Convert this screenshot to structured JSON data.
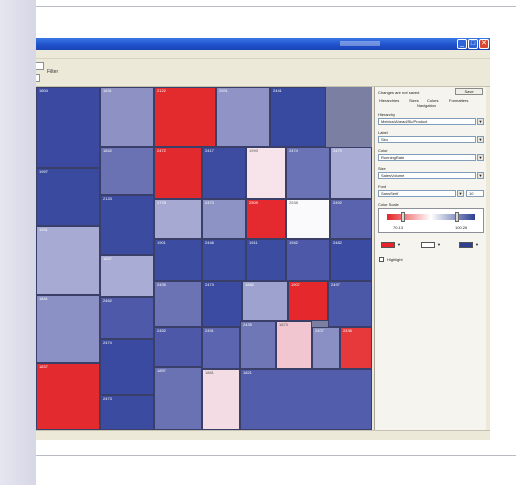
{
  "window": {
    "minimize_glyph": "_",
    "maximize_glyph": "□",
    "close_glyph": "✕"
  },
  "toolbar": {
    "filter_label": "Filter"
  },
  "panel": {
    "status_message": "Changes are not saved",
    "save_label": "Save",
    "tabs": [
      "Hierarchies",
      "Sizes",
      "Colors",
      "Formatters",
      "Navigation"
    ],
    "hierarchy_label": "Hierarchy",
    "hierarchy_value": "Metrics/Ahead/Sk/Product",
    "label_label": "Label",
    "label_value": "Sku",
    "color_label": "Color",
    "color_value": "RunningRate",
    "size_label": "Size",
    "size_value": "SalesVolume",
    "font_label": "Font",
    "font_value": "SansSerif",
    "font_size": "10",
    "color_scale_label": "Color Scale",
    "scale_min": "70.13",
    "scale_max": "100.26",
    "highlight_label": "Highlight",
    "dropdown_glyph": "▼"
  },
  "colors": {
    "scale_low": "#e52328",
    "scale_mid": "#ffffff",
    "scale_high": "#2c3f91"
  },
  "tiles": [
    {
      "label": "1604",
      "color": "#3b4aa0"
    },
    {
      "label": "1631",
      "color": "#8d91c4"
    },
    {
      "label": "2122",
      "color": "#e32a2d"
    },
    {
      "label": "2591",
      "color": "#8f93c6"
    },
    {
      "label": "2441",
      "color": "#384aa0"
    },
    {
      "label": "1997",
      "color": "#3a4b9f"
    },
    {
      "label": "1842",
      "color": "#6b72b4"
    },
    {
      "label": "2472",
      "color": "#e22a2e"
    },
    {
      "label": "2417",
      "color": "#3d4ca1"
    },
    {
      "label": "1993",
      "color": "#f7e4ea"
    },
    {
      "label": "2474",
      "color": "#6a73b5"
    },
    {
      "label": "2479",
      "color": "#a8acd4"
    },
    {
      "label": "1931",
      "color": "#a7abd4"
    },
    {
      "label": "2133",
      "color": "#3a4ba0"
    },
    {
      "label": "1778",
      "color": "#a6aad3"
    },
    {
      "label": "2473",
      "color": "#8e93c6"
    },
    {
      "label": "2509",
      "color": "#e42a2e"
    },
    {
      "label": "2538",
      "color": "#fafafd"
    },
    {
      "label": "2492",
      "color": "#5a63ae"
    },
    {
      "label": "1597",
      "color": "#a4a8d2"
    },
    {
      "label": "1837",
      "color": "#a9add5"
    },
    {
      "label": "1901",
      "color": "#3b4ca1"
    },
    {
      "label": "2446",
      "color": "#3d4da2"
    },
    {
      "label": "1911",
      "color": "#3b4ca1"
    },
    {
      "label": "1942",
      "color": "#4d59a8"
    },
    {
      "label": "2482",
      "color": "#3b4ba1"
    },
    {
      "label": "1888",
      "color": "#6c74b6"
    },
    {
      "label": "1841",
      "color": "#8c91c5"
    },
    {
      "label": "2462",
      "color": "#4e5aa9"
    },
    {
      "label": "2435",
      "color": "#6b73b5"
    },
    {
      "label": "2473",
      "color": "#3a4ba1"
    },
    {
      "label": "1882",
      "color": "#9ea2cf"
    },
    {
      "label": "1907",
      "color": "#e5282c"
    },
    {
      "label": "2497",
      "color": "#4b57a7"
    },
    {
      "label": "2452",
      "color": "#4d59a8"
    },
    {
      "label": "1837",
      "color": "#e32a2e"
    },
    {
      "label": "2474",
      "color": "#3a4aa0"
    },
    {
      "label": "2453",
      "color": "#e2292d"
    },
    {
      "label": "2491",
      "color": "#5c65af"
    },
    {
      "label": "2435",
      "color": "#6f77b7"
    },
    {
      "label": "1881",
      "color": "#f3dce3"
    },
    {
      "label": "1897",
      "color": "#6a72b4"
    },
    {
      "label": "2473",
      "color": "#3b4ba0"
    },
    {
      "label": "1873",
      "color": "#f2c6d0"
    },
    {
      "label": "2407",
      "color": "#8a8fc4"
    },
    {
      "label": "2436",
      "color": "#e7393c"
    },
    {
      "label": "1821",
      "color": "#525dab"
    }
  ]
}
